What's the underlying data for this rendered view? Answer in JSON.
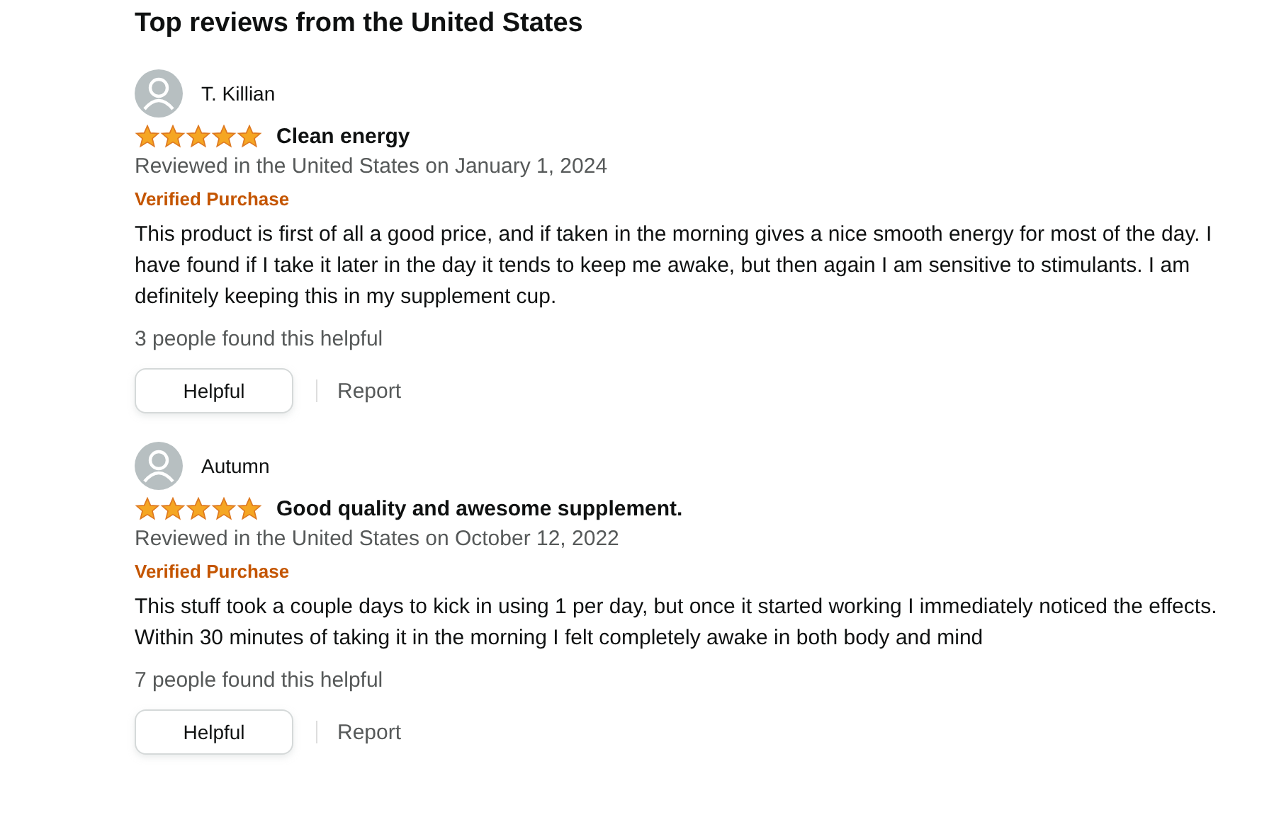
{
  "heading": "Top reviews from the United States",
  "reviews": [
    {
      "author": "T. Killian",
      "stars": 5,
      "title": "Clean energy",
      "date": "Reviewed in the United States on January 1, 2024",
      "badge": "Verified Purchase",
      "body": "This product is first of all a good price, and if taken in the morning gives a nice smooth energy for most of the day. I have found if I take it later in the day it tends to keep me awake, but then again I am sensitive to stimulants. I am definitely keeping this in my supplement cup.",
      "helpful_count": "3 people found this helpful",
      "helpful_button": "Helpful",
      "report_link": "Report"
    },
    {
      "author": "Autumn",
      "stars": 5,
      "title": "Good quality and awesome supplement.",
      "date": "Reviewed in the United States on October 12, 2022",
      "badge": "Verified Purchase",
      "body": "This stuff took a couple days to kick in using 1 per day, but once it started working I immediately noticed the effects. Within 30 minutes of taking it in the morning I felt completely awake in both body and mind",
      "helpful_count": "7 people found this helpful",
      "helpful_button": "Helpful",
      "report_link": "Report"
    }
  ]
}
